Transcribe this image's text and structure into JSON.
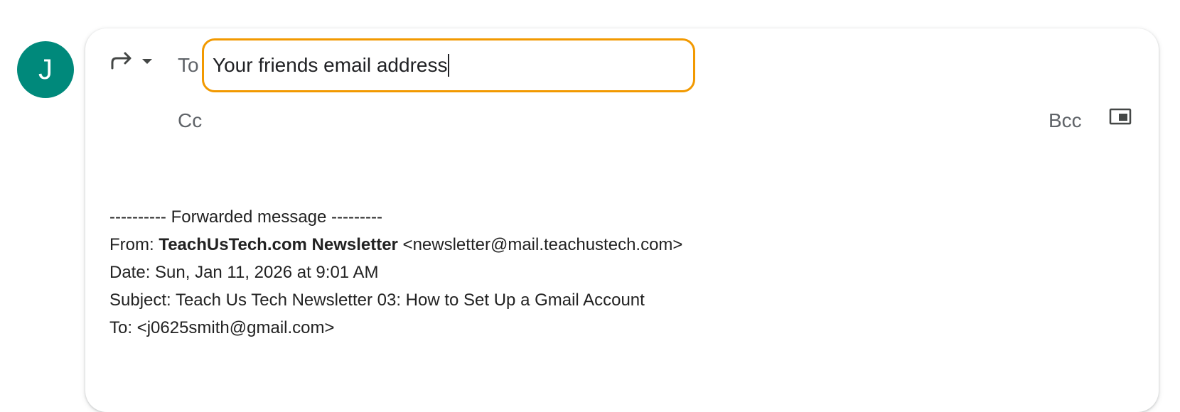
{
  "avatar": {
    "initial": "J",
    "color": "#00897b"
  },
  "compose": {
    "reply_type_icon": "forward-arrow-icon",
    "dropdown_icon": "caret-down-icon",
    "to_label": "To",
    "to_value": "Your friends email address",
    "to_focus_color": "#f29900",
    "cc_label": "Cc",
    "bcc_label": "Bcc",
    "popout_icon": "pop-out-icon"
  },
  "forwarded": {
    "header": "---------- Forwarded message ---------",
    "from_label": "From: ",
    "from_name": "TeachUsTech.com Newsletter",
    "from_email": " <newsletter@mail.teachustech.com>",
    "date": "Date: Sun, Jan 11, 2026 at 9:01 AM",
    "subject": "Subject: Teach Us Tech Newsletter 03: How to Set Up a Gmail Account",
    "to": "To: <j0625smith@gmail.com>"
  }
}
